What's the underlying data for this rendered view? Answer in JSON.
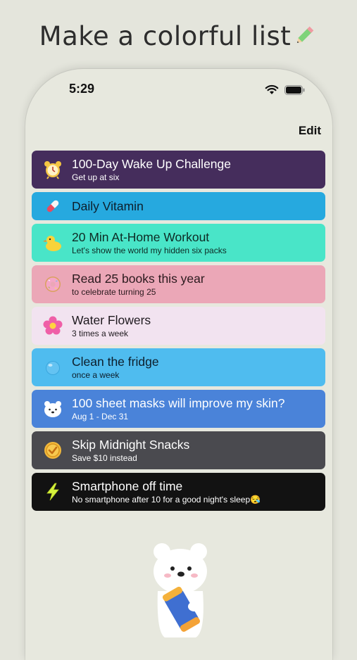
{
  "headline": "Make a colorful list",
  "status": {
    "time": "5:29"
  },
  "nav": {
    "edit_label": "Edit"
  },
  "items": [
    {
      "title": "100-Day Wake Up Challenge",
      "subtitle": "Get up at six",
      "icon": "alarm-clock-icon",
      "bg": "#452d5c",
      "fg": "#ffffff"
    },
    {
      "title": "Daily Vitamin",
      "subtitle": "",
      "icon": "pill-icon",
      "bg": "#26a9df",
      "fg": "#0d1e2b"
    },
    {
      "title": "20 Min At-Home Workout",
      "subtitle": "Let's show the world my hidden six packs",
      "icon": "duck-icon",
      "bg": "#49e5c8",
      "fg": "#0d2a24"
    },
    {
      "title": "Read 25 books this year",
      "subtitle": "to celebrate turning 25",
      "icon": "donut-icon",
      "bg": "#eba7b7",
      "fg": "#2b1a1e"
    },
    {
      "title": "Water Flowers",
      "subtitle": "3 times a week",
      "icon": "flower-icon",
      "bg": "#f2e3f0",
      "fg": "#1f1a1f"
    },
    {
      "title": "Clean the fridge",
      "subtitle": "once a week",
      "icon": "water-drop-icon",
      "bg": "#4fbcef",
      "fg": "#0d1e2b"
    },
    {
      "title": "100 sheet masks will improve my skin?",
      "subtitle": "Aug 1 - Dec 31",
      "icon": "polar-bear-icon",
      "bg": "#4a83d9",
      "fg": "#ffffff"
    },
    {
      "title": "Skip Midnight Snacks",
      "subtitle": "Save $10 instead",
      "icon": "check-coin-icon",
      "bg": "#4a4a4f",
      "fg": "#ffffff"
    },
    {
      "title": "Smartphone off time",
      "subtitle": "No smartphone after 10 for a good night's sleep😪",
      "icon": "lightning-icon",
      "bg": "#121212",
      "fg": "#ffffff"
    }
  ]
}
